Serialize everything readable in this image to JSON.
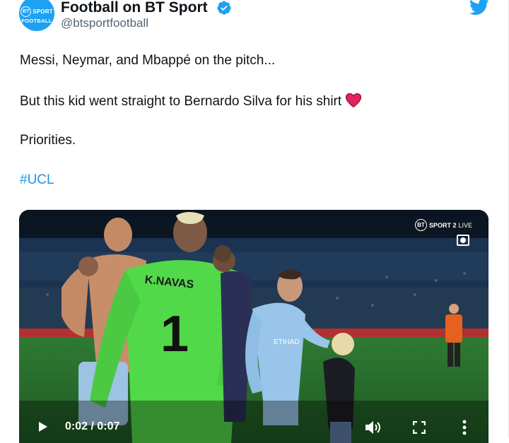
{
  "account": {
    "display_name": "Football on BT Sport",
    "handle": "@btsportfootball",
    "avatar_line1": "BT SPORT",
    "avatar_bt": "BT",
    "avatar_sport": "SPORT",
    "avatar_line2": "FOOTBALL"
  },
  "tweet": {
    "line1": "Messi, Neymar, and Mbappé on the pitch...",
    "line2": "But this kid went straight to Bernardo Silva for his shirt",
    "line3": "Priorities.",
    "hashtag": "#UCL"
  },
  "video": {
    "channel_bt": "BT",
    "channel_name": "SPORT 2",
    "channel_live": "LIVE",
    "shirt_name": "K.NAVAS",
    "shirt_number": "1",
    "sponsor": "ETIHAD",
    "time_display": "0:02 / 0:07"
  },
  "colors": {
    "accent": "#1da1f2",
    "hashtag": "#1b95e0",
    "heart": "#e0245e",
    "gk_shirt": "#52d94a",
    "city_blue": "#98c5e9"
  },
  "icons": [
    "verified-icon",
    "twitter-logo-icon",
    "heart-icon",
    "play-icon",
    "volume-icon",
    "fullscreen-icon",
    "more-icon"
  ]
}
